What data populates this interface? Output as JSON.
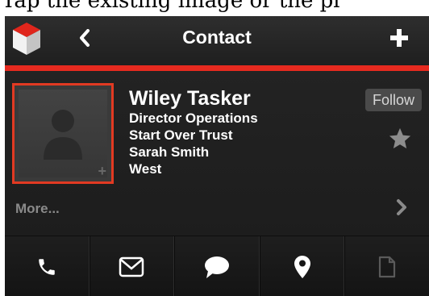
{
  "page_caption": "Tap the existing image or the pl",
  "navbar": {
    "title": "Contact"
  },
  "contact": {
    "name": "Wiley Tasker",
    "title": "Director Operations",
    "company": "Start Over Trust",
    "owner": "Sarah Smith",
    "region": "West",
    "avatar_badge": "+"
  },
  "follow_label": "Follow",
  "more_label": "More...",
  "actions": [
    "phone-icon",
    "mail-icon",
    "chat-icon",
    "location-pin-icon",
    "document-icon"
  ],
  "colors": {
    "accent": "#e62a1f",
    "background": "#1b1b1b",
    "text": "#ffffff",
    "muted": "#8a8a8a"
  }
}
